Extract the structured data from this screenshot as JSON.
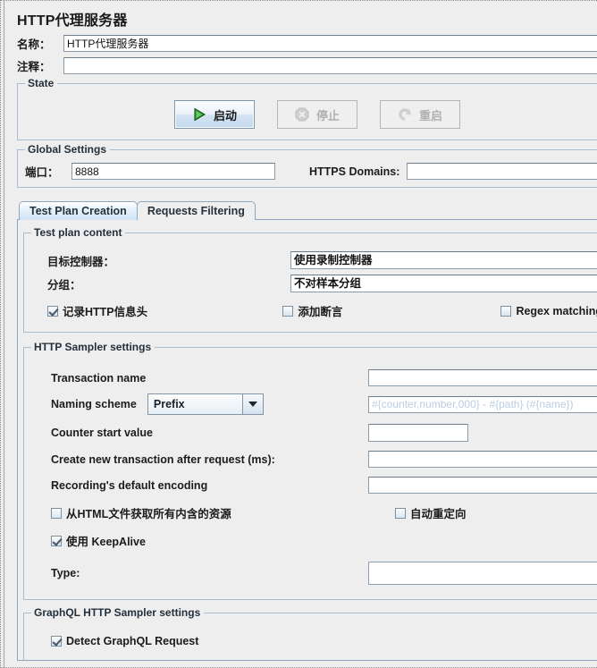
{
  "window": {
    "title": "HTTP代理服务器"
  },
  "identity": {
    "name_label": "名称：",
    "name_value": "HTTP代理服务器",
    "comment_label": "注释：",
    "comment_value": ""
  },
  "state": {
    "group_label": "State",
    "buttons": [
      {
        "label": "启动",
        "icon": "play-icon",
        "enabled": true
      },
      {
        "label": "停止",
        "icon": "stop-icon",
        "enabled": false
      },
      {
        "label": "重启",
        "icon": "restart-icon",
        "enabled": false
      }
    ]
  },
  "global_settings": {
    "group_label": "Global Settings",
    "port_label": "端口：",
    "port_value": "8888",
    "https_domains_label": "HTTPS Domains:",
    "https_domains_value": ""
  },
  "tabs": [
    {
      "label": "Test Plan Creation",
      "selected": true
    },
    {
      "label": "Requests Filtering",
      "selected": false
    }
  ],
  "test_plan_content": {
    "group_label": "Test plan content",
    "target_controller_label": "目标控制器：",
    "target_controller_value": "使用录制控制器",
    "grouping_label": "分组：",
    "grouping_value": "不对样本分组",
    "capture_headers_label": "记录HTTP信息头",
    "capture_headers_checked": true,
    "add_assertions_label": "添加断言",
    "add_assertions_checked": false,
    "regex_matching_label": "Regex matching",
    "regex_matching_checked": false
  },
  "http_sampler_settings": {
    "group_label": "HTTP Sampler settings",
    "transaction_name_label": "Transaction name",
    "transaction_name_value": "",
    "naming_scheme_label": "Naming scheme",
    "naming_scheme_value": "Prefix",
    "naming_pattern_placeholder": "#{counter,number,000} - #{path} (#{name})",
    "naming_pattern_value": "",
    "counter_start_label": "Counter start value",
    "counter_start_value": "",
    "new_transaction_label": "Create new transaction after request (ms):",
    "new_transaction_value": "",
    "default_encoding_label": "Recording's default encoding",
    "default_encoding_value": "",
    "retrieve_resources_label": "从HTML文件获取所有内含的资源",
    "retrieve_resources_checked": false,
    "follow_redirects_label": "自动重定向",
    "follow_redirects_checked": false,
    "use_keepalive_label": "使用 KeepAlive",
    "use_keepalive_checked": true,
    "type_label": "Type:",
    "type_value": ""
  },
  "graphql_settings": {
    "group_label": "GraphQL HTTP Sampler settings",
    "detect_graphql_label": "Detect GraphQL Request",
    "detect_graphql_checked": true
  },
  "colors": {
    "background": "#eeeeee",
    "border": "#a9bdd0",
    "field_bg": "#ffffff",
    "play_green": "#2f9e2f",
    "disabled_gray": "#b0b0b0",
    "tab_selected": "#cfe4f6",
    "placeholder": "#b9cee3"
  }
}
